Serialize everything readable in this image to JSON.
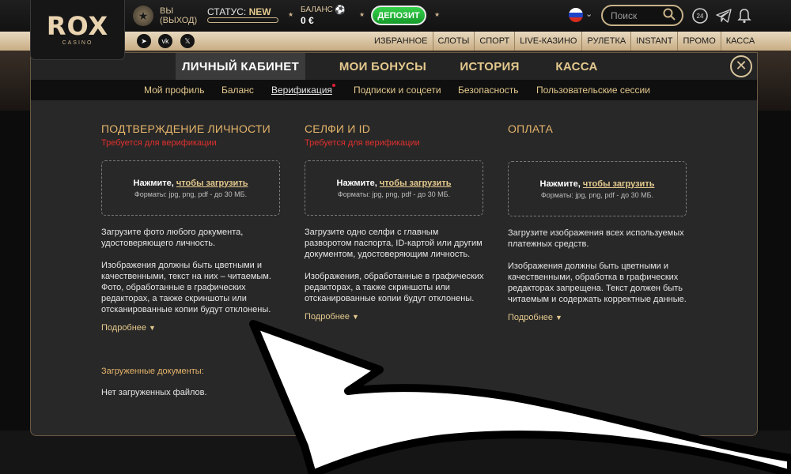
{
  "header": {
    "logo": {
      "main": "ROX",
      "sub": "CASINO"
    },
    "user": {
      "line1": "ВЫ",
      "line2": "(ВЫХОД)"
    },
    "status": {
      "label": "СТАТУС:",
      "value": "NEW"
    },
    "balance": {
      "label": "БАЛАНС",
      "value": "0 €"
    },
    "deposit_label": "ДЕПОЗИТ",
    "search_placeholder": "Поиск",
    "support_badge": "24"
  },
  "navbar": {
    "links": [
      "ИЗБРАННОЕ",
      "СЛОТЫ",
      "СПОРТ",
      "LIVE-КАЗИНО",
      "РУЛЕТКА",
      "INSTANT",
      "ПРОМО",
      "КАССА"
    ]
  },
  "modal": {
    "tabs": [
      "ЛИЧНЫЙ КАБИНЕТ",
      "МОИ БОНУСЫ",
      "ИСТОРИЯ",
      "КАССА"
    ],
    "active_tab": "ЛИЧНЫЙ КАБИНЕТ",
    "close_label": "✕",
    "subnav": [
      "Мой профиль",
      "Баланс",
      "Верификация",
      "Подписки и соцсети",
      "Безопасность",
      "Пользовательские сессии"
    ],
    "active_subnav": "Верификация",
    "upload": {
      "prefix": "Нажмите,",
      "link": "чтобы загрузить",
      "formats": "Форматы: jpg, png, pdf - до 30 МБ."
    },
    "more_label": "Подробнее",
    "columns": [
      {
        "title": "ПОДТВЕРЖДЕНИЕ ЛИЧНОСТИ",
        "required": "Требуется для верификации",
        "p1": "Загрузите фото любого документа, удостоверяющего личность.",
        "p2": "Изображения должны быть цветными и качественными, текст на них – читаемым. Фото, обработанные в графических редакторах, а также скриншоты или отсканированные копии будут отклонены."
      },
      {
        "title": "СЕЛФИ И ID",
        "required": "Требуется для верификации",
        "p1": "Загрузите одно селфи с главным разворотом паспорта, ID-картой или другим документом, удостоверяющим личность.",
        "p2": "Изображения, обработанные в графических редакторах, а также скриншоты или отсканированные копии будут отклонены."
      },
      {
        "title": "ОПЛАТА",
        "required": "",
        "p1": "Загрузите изображения всех используемых платежных средств.",
        "p2": "Изображения должны быть цветными и качественными, обработка в графических редакторах запрещена. Текст должен быть читаемым и содержать корректные данные."
      }
    ],
    "docs": {
      "label": "Загруженные документы:",
      "empty": "Нет загруженных файлов."
    }
  },
  "colors": {
    "accent": "#e4c98e",
    "required": "#e0302e",
    "deposit": "#1fb535"
  }
}
